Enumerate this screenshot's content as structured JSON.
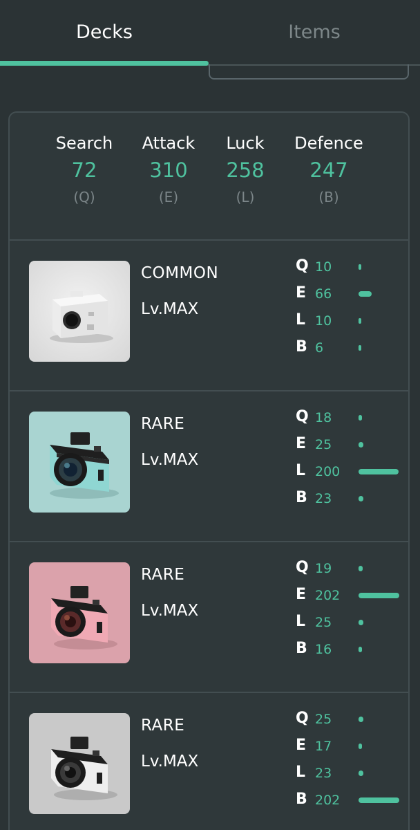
{
  "tabs": {
    "decks_label": "Decks",
    "items_label": "Items",
    "active": "Decks"
  },
  "summary": {
    "stats": [
      {
        "name": "Search",
        "value": "72",
        "key": "(Q)"
      },
      {
        "name": "Attack",
        "value": "310",
        "key": "(E)"
      },
      {
        "name": "Luck",
        "value": "258",
        "key": "(L)"
      },
      {
        "name": "Defence",
        "value": "247",
        "key": "(B)"
      }
    ]
  },
  "colors": {
    "accent": "#4fc29f",
    "background": "#2b3335",
    "panel": "#2f383a",
    "muted": "#7c8689"
  },
  "cards": [
    {
      "rarity": "COMMON",
      "level": "Lv.MAX",
      "image_icon": "white-camera-icon",
      "stats": [
        {
          "letter": "Q",
          "value": "10",
          "amount": 10
        },
        {
          "letter": "E",
          "value": "66",
          "amount": 66
        },
        {
          "letter": "L",
          "value": "10",
          "amount": 10
        },
        {
          "letter": "B",
          "value": "6",
          "amount": 6
        }
      ]
    },
    {
      "rarity": "RARE",
      "level": "Lv.MAX",
      "image_icon": "teal-camera-icon",
      "stats": [
        {
          "letter": "Q",
          "value": "18",
          "amount": 18
        },
        {
          "letter": "E",
          "value": "25",
          "amount": 25
        },
        {
          "letter": "L",
          "value": "200",
          "amount": 200
        },
        {
          "letter": "B",
          "value": "23",
          "amount": 23
        }
      ]
    },
    {
      "rarity": "RARE",
      "level": "Lv.MAX",
      "image_icon": "pink-camera-icon",
      "stats": [
        {
          "letter": "Q",
          "value": "19",
          "amount": 19
        },
        {
          "letter": "E",
          "value": "202",
          "amount": 202
        },
        {
          "letter": "L",
          "value": "25",
          "amount": 25
        },
        {
          "letter": "B",
          "value": "16",
          "amount": 16
        }
      ]
    },
    {
      "rarity": "RARE",
      "level": "Lv.MAX",
      "image_icon": "gray-camera-icon",
      "stats": [
        {
          "letter": "Q",
          "value": "25",
          "amount": 25
        },
        {
          "letter": "E",
          "value": "17",
          "amount": 17
        },
        {
          "letter": "L",
          "value": "23",
          "amount": 23
        },
        {
          "letter": "B",
          "value": "202",
          "amount": 202
        }
      ]
    }
  ]
}
